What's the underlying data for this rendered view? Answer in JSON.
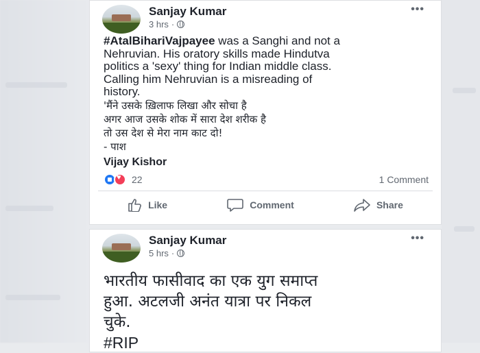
{
  "posts": [
    {
      "author": "Sanjay Kumar",
      "time": "3 hrs",
      "dot": "·",
      "more": "•••",
      "hashtag": "#AtalBihariVajpayee",
      "lines": [
        " was a Sanghi and not a",
        "Nehruvian. His oratory skills made Hindutva",
        "politics a 'sexy' thing for Indian middle class.",
        "Calling him Nehruvian is a misreading of",
        "history."
      ],
      "poem": [
        "'मैंने उसके ख़िलाफ लिखा और सोचा है",
        "अगर आज उसके शोक में सारा देश शरीक है",
        "तो उस देश से मेरा नाम काट दो!",
        "- पाश"
      ],
      "signature": "Vijay Kishor",
      "reaction_count": "22",
      "comment_count": "1 Comment",
      "actions": {
        "like": "Like",
        "comment": "Comment",
        "share": "Share"
      }
    },
    {
      "author": "Sanjay Kumar",
      "time": "5 hrs",
      "dot": "·",
      "more": "•••",
      "lines": [
        "भारतीय फासीवाद का एक युग समाप्त",
        "हुआ. अटलजी अनंत यात्रा पर निकल",
        "चुके."
      ],
      "tag": "#RIP"
    }
  ],
  "colors": {
    "facebook_blue": "#2078f4",
    "love_red": "#f33e58",
    "text": "#1d2129",
    "secondary": "#606770",
    "page_bg": "#e9ebee"
  }
}
